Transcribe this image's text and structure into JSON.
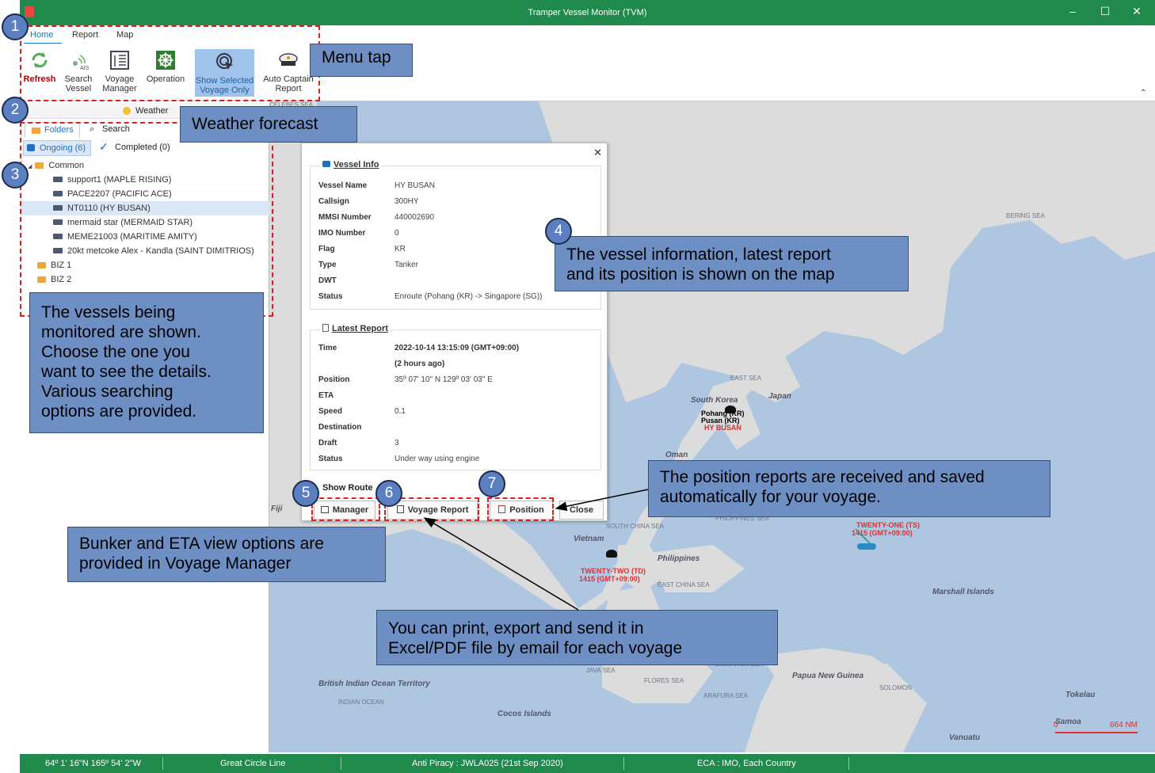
{
  "window": {
    "title": "Tramper Vessel Monitor (TVM)",
    "minimize": "–",
    "maximize": "☐",
    "close": "✕"
  },
  "ribbon": {
    "tabs": [
      {
        "label": "Home"
      },
      {
        "label": "Report"
      },
      {
        "label": "Map"
      }
    ],
    "buttons": {
      "refresh": "Refresh",
      "search_vessel": "Search\nVessel",
      "voyage_manager": "Voyage\nManager",
      "operation": "Operation",
      "show_selected": "Show Selected\nVoyage Only",
      "auto_captain": "Auto Captain\nReport"
    },
    "collapse": "⌃"
  },
  "weather": {
    "label": "Weather"
  },
  "left": {
    "tabs": {
      "folders": "Folders",
      "search": "Search"
    },
    "subtabs": {
      "ongoing": "Ongoing (6)",
      "completed": "Completed (0)"
    },
    "tree": [
      {
        "type": "folder",
        "label": "Common",
        "indent": 0
      },
      {
        "type": "vessel",
        "label": "support1 (MAPLE RISING)",
        "indent": 1
      },
      {
        "type": "vessel",
        "label": "PACE2207 (PACIFIC ACE)",
        "indent": 1
      },
      {
        "type": "vessel",
        "label": "NT0110 (HY BUSAN)",
        "indent": 1,
        "selected": true
      },
      {
        "type": "vessel",
        "label": "mermaid star (MERMAID STAR)",
        "indent": 1
      },
      {
        "type": "vessel",
        "label": "MEME21003 (MARITIME AMITY)",
        "indent": 1
      },
      {
        "type": "vessel",
        "label": "20kt metcoke Alex - Kandla (SAINT DIMITRIOS)",
        "indent": 1
      },
      {
        "type": "folder",
        "label": "BIZ 1",
        "indent": 0
      },
      {
        "type": "folder",
        "label": "BIZ 2",
        "indent": 0
      }
    ]
  },
  "popup": {
    "close": "✕",
    "vessel_info": {
      "title": "Vessel Info",
      "rows": [
        {
          "k": "Vessel Name",
          "v": "HY BUSAN"
        },
        {
          "k": "Callsign",
          "v": "300HY"
        },
        {
          "k": "MMSI Number",
          "v": "440002690"
        },
        {
          "k": "IMO Number",
          "v": "0"
        },
        {
          "k": "Flag",
          "v": "KR"
        },
        {
          "k": "Type",
          "v": "Tanker"
        },
        {
          "k": "DWT",
          "v": ""
        },
        {
          "k": "Status",
          "v": "Enroute (Pohang (KR) -> Singapore (SG))"
        }
      ]
    },
    "latest_report": {
      "title": "Latest Report",
      "rows": [
        {
          "k": "Time",
          "v": "2022-10-14 13:15:09 (GMT+09:00)",
          "bold": true
        },
        {
          "k": "",
          "v": "(2 hours ago)",
          "bold": true
        },
        {
          "k": "Position",
          "v": "35º 07' 10\" N 129º 03' 03\" E"
        },
        {
          "k": "ETA",
          "v": ""
        },
        {
          "k": "Speed",
          "v": "0.1"
        },
        {
          "k": "Destination",
          "v": ""
        },
        {
          "k": "Draft",
          "v": "3"
        },
        {
          "k": "Status",
          "v": "Under way using engine"
        }
      ]
    },
    "show_route": "Show Route",
    "buttons": {
      "manager": "Manager",
      "voyage_report": "Voyage Report",
      "position": "Position",
      "close": "Close"
    }
  },
  "map": {
    "labels": [
      {
        "text": "BERING SEA"
      },
      {
        "text": "EAST SEA"
      },
      {
        "text": "Japan"
      },
      {
        "text": "South Korea"
      },
      {
        "text": "Vietnam"
      },
      {
        "text": "Philippines"
      },
      {
        "text": "Marshall Islands"
      },
      {
        "text": "PHILIPPINES SEA"
      },
      {
        "text": "SOUTH CHINA SEA"
      },
      {
        "text": "JAVA SEA"
      },
      {
        "text": "FLORES SEA"
      },
      {
        "text": "BANDA SEA"
      },
      {
        "text": "ARAFURA SEA"
      },
      {
        "text": "Papua New Guinea"
      },
      {
        "text": "SOLOMON"
      },
      {
        "text": "BISMARCK SEA"
      },
      {
        "text": "British Indian Ocean Territory"
      },
      {
        "text": "INDIAN OCEAN"
      },
      {
        "text": "Cocos Islands"
      },
      {
        "text": "Tokelau"
      },
      {
        "text": "Samoa"
      },
      {
        "text": "Vanuatu"
      },
      {
        "text": "Fiji"
      },
      {
        "text": "Oman"
      },
      {
        "text": "EAST CHINA SEA"
      },
      {
        "text": "CELEBES SEA"
      }
    ],
    "vessels": [
      {
        "name": "Pohang (KR)",
        "sub": "Pusan (KR)",
        "label": "HY BUSAN"
      },
      {
        "name": "TWENTY-ONE (TS)",
        "sub": "1415 (GMT+09:00)"
      },
      {
        "name": "TWENTY-TWO (TD)",
        "sub": "1415 (GMT+09:00)"
      }
    ],
    "scale": {
      "left": "0",
      "right": "664 NM"
    }
  },
  "status": {
    "coords": "64º 1' 16\"N 165º 54' 2\"W",
    "line": "Great Circle Line",
    "piracy": "Anti Piracy : JWLA025 (21st Sep 2020)",
    "eca": "ECA : IMO, Each Country"
  },
  "callouts": {
    "c1": "Menu tap",
    "c2": "Weather forecast",
    "c3": "The vessels being\nmonitored are shown.\nChoose the one you\nwant to see the details.\nVarious searching\noptions are provided.",
    "c4": "The vessel information, latest report\nand its position is shown on the map",
    "c5": " Bunker and ETA view options are\nprovided in  Voyage Manager",
    "c6": "You can print, export and send it in\nExcel/PDF file by email for each voyage",
    "c7": "The position reports are received and saved\nautomatically for your voyage."
  },
  "badges": [
    "1",
    "2",
    "3",
    "4",
    "5",
    "6",
    "7"
  ],
  "colors": {
    "titlebar": "#1f8a4c",
    "callout": "#6e8fc4",
    "badge": "#5b7fc0",
    "dash": "#e02020",
    "sea": "#aec6e0",
    "land": "#dcdcdc"
  }
}
